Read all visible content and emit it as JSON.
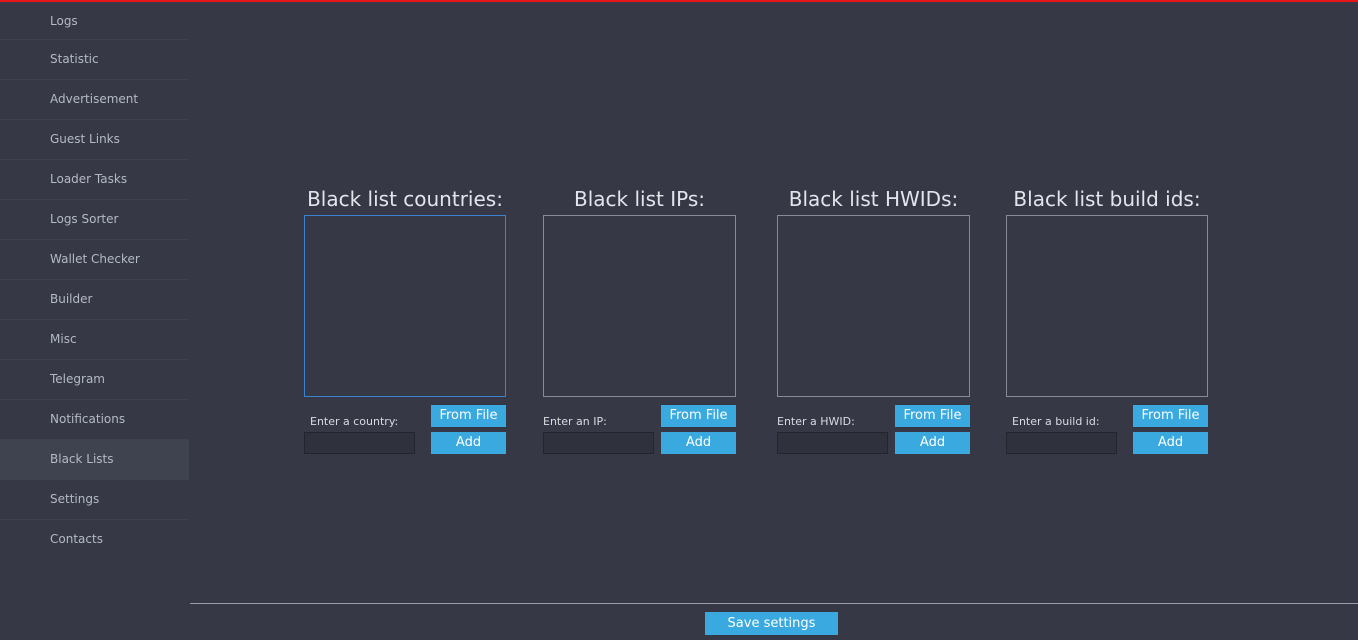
{
  "colors": {
    "background": "#363945",
    "accent_line": "#e8141b",
    "button": "#39a9e0",
    "focus_border": "#3a83d0"
  },
  "sidebar": {
    "items": [
      {
        "label": "Logs"
      },
      {
        "label": "Statistic"
      },
      {
        "label": "Advertisement"
      },
      {
        "label": "Guest Links"
      },
      {
        "label": "Loader Tasks"
      },
      {
        "label": "Logs Sorter"
      },
      {
        "label": "Wallet Checker"
      },
      {
        "label": "Builder"
      },
      {
        "label": "Misc"
      },
      {
        "label": "Telegram"
      },
      {
        "label": "Notifications"
      },
      {
        "label": "Black Lists",
        "active": true
      },
      {
        "label": "Settings"
      },
      {
        "label": "Contacts"
      }
    ]
  },
  "panels": {
    "countries": {
      "title": "Black list countries:",
      "input_label": "Enter a country:",
      "input_value": "",
      "from_file_label": "From File",
      "add_label": "Add"
    },
    "ips": {
      "title": "Black list IPs:",
      "input_label": "Enter an IP:",
      "input_value": "",
      "from_file_label": "From File",
      "add_label": "Add"
    },
    "hwids": {
      "title": "Black list HWIDs:",
      "input_label": "Enter a HWID:",
      "input_value": "",
      "from_file_label": "From File",
      "add_label": "Add"
    },
    "build_ids": {
      "title": "Black list build ids:",
      "input_label": "Enter a build id:",
      "input_value": "",
      "from_file_label": "From File",
      "add_label": "Add"
    }
  },
  "footer": {
    "save_label": "Save settings"
  }
}
